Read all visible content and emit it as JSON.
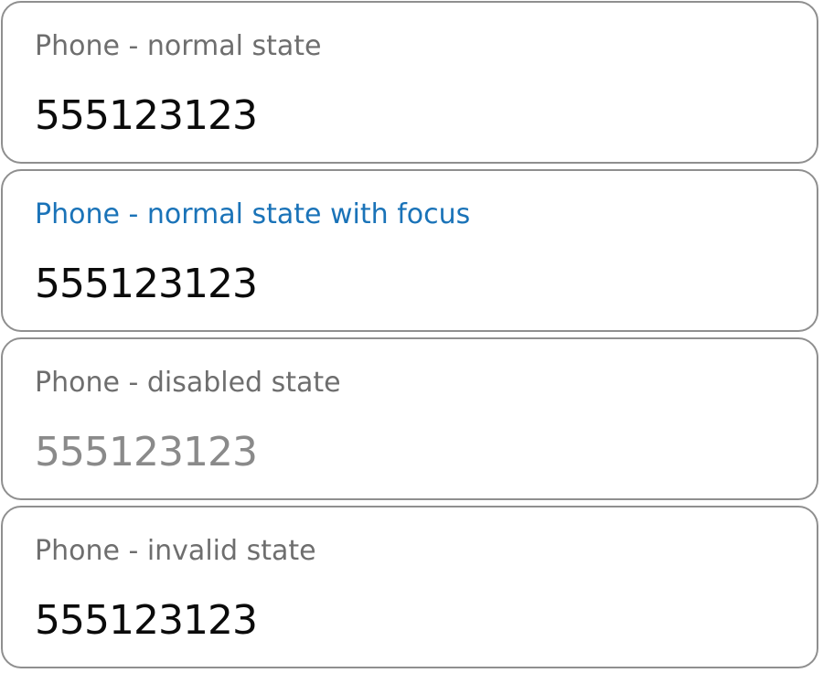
{
  "fields": [
    {
      "label": "Phone - normal state",
      "value": "555123123",
      "state": "normal"
    },
    {
      "label": "Phone - normal state with focus",
      "value": "555123123",
      "state": "focused"
    },
    {
      "label": "Phone - disabled state",
      "value": "555123123",
      "state": "disabled"
    },
    {
      "label": "Phone - invalid state",
      "value": "555123123",
      "state": "invalid"
    }
  ],
  "colors": {
    "border": "#8f8f8f",
    "label": "#6e6e6e",
    "label_focused": "#1a73b8",
    "value": "#0b0b0b",
    "value_disabled": "#8a8a8a"
  }
}
